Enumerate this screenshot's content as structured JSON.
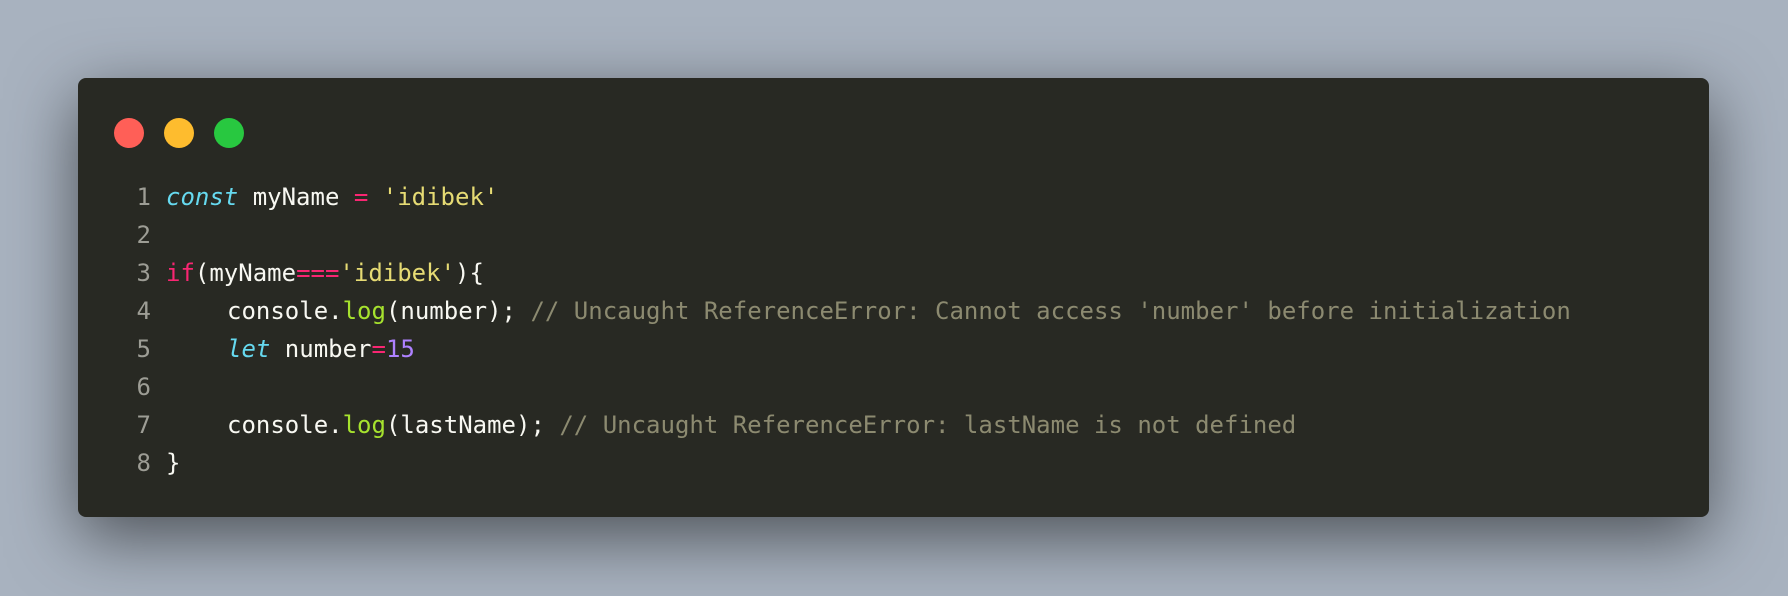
{
  "colors": {
    "background": "#a8b2bf",
    "editor_bg": "#282923",
    "dot_red": "#ff5f57",
    "dot_yellow": "#febc2e",
    "dot_green": "#28c840",
    "line_number": "#9d9d95",
    "plain": "#f8f8f2",
    "storage": "#66d9ef",
    "keyword": "#f92672",
    "operator": "#f92672",
    "string": "#e6db74",
    "function": "#a6e22e",
    "number": "#ae81ff",
    "comment": "#8c8a70"
  },
  "window_controls": [
    "close",
    "minimize",
    "maximize"
  ],
  "lines": [
    {
      "number": "1",
      "tokens": [
        {
          "t": "const",
          "c": "storage",
          "i": true
        },
        {
          "t": " myName ",
          "c": "plain"
        },
        {
          "t": "=",
          "c": "operator"
        },
        {
          "t": " ",
          "c": "plain"
        },
        {
          "t": "'idibek'",
          "c": "string"
        }
      ]
    },
    {
      "number": "2",
      "tokens": []
    },
    {
      "number": "3",
      "tokens": [
        {
          "t": "if",
          "c": "keyword"
        },
        {
          "t": "(myName",
          "c": "plain"
        },
        {
          "t": "===",
          "c": "operator"
        },
        {
          "t": "'idibek'",
          "c": "string"
        },
        {
          "t": "){",
          "c": "plain"
        }
      ]
    },
    {
      "number": "4",
      "indent": true,
      "tokens": [
        {
          "t": "console.",
          "c": "plain"
        },
        {
          "t": "log",
          "c": "function"
        },
        {
          "t": "(number); ",
          "c": "plain"
        },
        {
          "t": "// Uncaught ReferenceError: Cannot access 'number' before initialization",
          "c": "comment"
        }
      ]
    },
    {
      "number": "5",
      "indent": true,
      "tokens": [
        {
          "t": "let",
          "c": "storage",
          "i": true
        },
        {
          "t": " number",
          "c": "plain"
        },
        {
          "t": "=",
          "c": "operator"
        },
        {
          "t": "15",
          "c": "number"
        }
      ]
    },
    {
      "number": "6",
      "tokens": []
    },
    {
      "number": "7",
      "indent": true,
      "tokens": [
        {
          "t": "console.",
          "c": "plain"
        },
        {
          "t": "log",
          "c": "function"
        },
        {
          "t": "(lastName); ",
          "c": "plain"
        },
        {
          "t": "// Uncaught ReferenceError: lastName is not defined",
          "c": "comment"
        }
      ]
    },
    {
      "number": "8",
      "tokens": [
        {
          "t": "}",
          "c": "plain"
        }
      ]
    }
  ]
}
